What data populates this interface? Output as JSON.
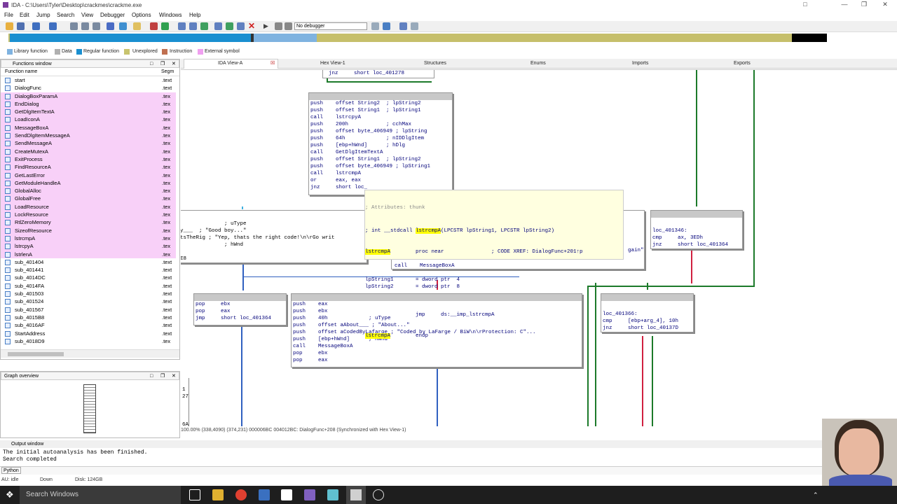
{
  "window": {
    "title": "IDA - C:\\Users\\Tyler\\Desktop\\crackmes\\crackme.exe"
  },
  "menu": [
    "File",
    "Edit",
    "Jump",
    "Search",
    "View",
    "Debugger",
    "Options",
    "Windows",
    "Help"
  ],
  "toolbar": {
    "debugger_select": "No debugger"
  },
  "legend": [
    {
      "label": "Library function",
      "color": "#7fb3e0"
    },
    {
      "label": "Data",
      "color": "#b0b0b0"
    },
    {
      "label": "Regular function",
      "color": "#1a8fd0"
    },
    {
      "label": "Unexplored",
      "color": "#c8c46e"
    },
    {
      "label": "Instruction",
      "color": "#c07050"
    },
    {
      "label": "External symbol",
      "color": "#f0a0f0"
    }
  ],
  "functions_window": {
    "title": "Functions window",
    "col_name": "Function name",
    "col_seg": "Segm",
    "rows": [
      {
        "name": "start",
        "seg": ".text",
        "ext": false
      },
      {
        "name": "DialogFunc",
        "seg": ".text",
        "ext": false
      },
      {
        "name": "DialogBoxParamA",
        "seg": ".tex",
        "ext": true
      },
      {
        "name": "EndDialog",
        "seg": ".tex",
        "ext": true
      },
      {
        "name": "GetDlgItemTextA",
        "seg": ".tex",
        "ext": true
      },
      {
        "name": "LoadIconA",
        "seg": ".tex",
        "ext": true
      },
      {
        "name": "MessageBoxA",
        "seg": ".tex",
        "ext": true
      },
      {
        "name": "SendDlgItemMessageA",
        "seg": ".tex",
        "ext": true
      },
      {
        "name": "SendMessageA",
        "seg": ".tex",
        "ext": true
      },
      {
        "name": "CreateMutexA",
        "seg": ".tex",
        "ext": true
      },
      {
        "name": "ExitProcess",
        "seg": ".tex",
        "ext": true
      },
      {
        "name": "FindResourceA",
        "seg": ".tex",
        "ext": true
      },
      {
        "name": "GetLastError",
        "seg": ".tex",
        "ext": true
      },
      {
        "name": "GetModuleHandleA",
        "seg": ".tex",
        "ext": true
      },
      {
        "name": "GlobalAlloc",
        "seg": ".tex",
        "ext": true
      },
      {
        "name": "GlobalFree",
        "seg": ".tex",
        "ext": true
      },
      {
        "name": "LoadResource",
        "seg": ".tex",
        "ext": true
      },
      {
        "name": "LockResource",
        "seg": ".tex",
        "ext": true
      },
      {
        "name": "RtlZeroMemory",
        "seg": ".tex",
        "ext": true
      },
      {
        "name": "SizeofResource",
        "seg": ".tex",
        "ext": true
      },
      {
        "name": "lstrcmpA",
        "seg": ".tex",
        "ext": true
      },
      {
        "name": "lstrcpyA",
        "seg": ".tex",
        "ext": true
      },
      {
        "name": "lstrlenA",
        "seg": ".tex",
        "ext": true
      },
      {
        "name": "sub_401404",
        "seg": ".text",
        "ext": false
      },
      {
        "name": "sub_401441",
        "seg": ".text",
        "ext": false
      },
      {
        "name": "sub_4014DC",
        "seg": ".text",
        "ext": false
      },
      {
        "name": "sub_4014FA",
        "seg": ".text",
        "ext": false
      },
      {
        "name": "sub_401503",
        "seg": ".text",
        "ext": false
      },
      {
        "name": "sub_401524",
        "seg": ".text",
        "ext": false
      },
      {
        "name": "sub_401567",
        "seg": ".text",
        "ext": false
      },
      {
        "name": "sub_4015B8",
        "seg": ".text",
        "ext": false
      },
      {
        "name": "sub_4016AF",
        "seg": ".text",
        "ext": false
      },
      {
        "name": "StartAddress",
        "seg": ".text",
        "ext": false
      },
      {
        "name": "sub_4018D9",
        "seg": ".tex",
        "ext": false
      }
    ]
  },
  "graph_overview": {
    "title": "Graph overview"
  },
  "tabs": [
    "IDA View-A",
    "Hex View-1",
    "Structures",
    "Enums",
    "Imports",
    "Exports"
  ],
  "nodes": {
    "top": "jnz     short loc_401278",
    "main": "push    offset String2  ; lpString2\npush    offset String1  ; lpString1\ncall    lstrcpyA\npush    200h            ; cchMax\npush    offset byte_406949 ; lpString\npush    64h             ; nIDDlgItem\npush    [ebp+hWnd]      ; hDlg\ncall    GetDlgItemTextA\npush    offset String1  ; lpString2\npush    offset byte_406949 ; lpString1\ncall    lstrcmpA\nor      eax, eax\njnz     short loc_",
    "left_mid": "              ; uType\ny___  ; \"Good boy...\"\ntsTheRig ; \"Yep, thats the right code!\\n\\rGo writ\n              ; hWnd\n\nE8",
    "right_mid_frag": "gain\"",
    "call_msg": "call    MessageBoxA",
    "loc346": "loc_401346:\ncmp     ax, 3EDh\njnz     short loc_401364",
    "pop_node": "pop     ebx\npop     eax\njmp     short loc_401364",
    "about_node": "push    eax\npush    ebx\npush    40h             ; uType\npush    offset aAbout___ ; \"About...\"\npush    offset aCodedByLafarge ; \"Coded by LaFarge / BiW\\n\\rProtection: C\"...\npush    [ebp+hWnd]      ; hWnd\ncall    MessageBoxA\npop     ebx\npop     eax",
    "loc366": "loc_401366:\ncmp     [ebp+arg_4], 10h\njnz     short loc_40137D",
    "left_edge": "1\n27\n\n\n\n6A"
  },
  "tooltip": {
    "attr": "; Attributes: thunk",
    "decl_pre": "; int __stdcall ",
    "decl_hl": "lstrcmpA",
    "decl_post": "(LPCSTR lpString1, LPCSTR lpString2)",
    "proc_name": "lstrcmpA",
    "proc_rest": "        proc near               ; CODE XREF: DialogFunc+201↑p",
    "args": "lpString1       = dword ptr  4\nlpString2       = dword ptr  8",
    "jmp": "                jmp     ds:__imp_lstrcmpA",
    "endp_name": "lstrcmpA",
    "endp_rest": "        endp"
  },
  "status_line": "100.00% (338,4090) (374,231) 000006BC 004012BC: DialogFunc+208 (Synchronized with Hex View-1)",
  "output": {
    "title": "Output window",
    "text": "The initial autoanalysis has been finished.\nSearch completed",
    "python_button": "Python"
  },
  "idle_bar": {
    "state": "AU:  idle",
    "dir": "Down",
    "disk": "Disk: 124GB"
  },
  "taskbar": {
    "search": "Search Windows"
  }
}
